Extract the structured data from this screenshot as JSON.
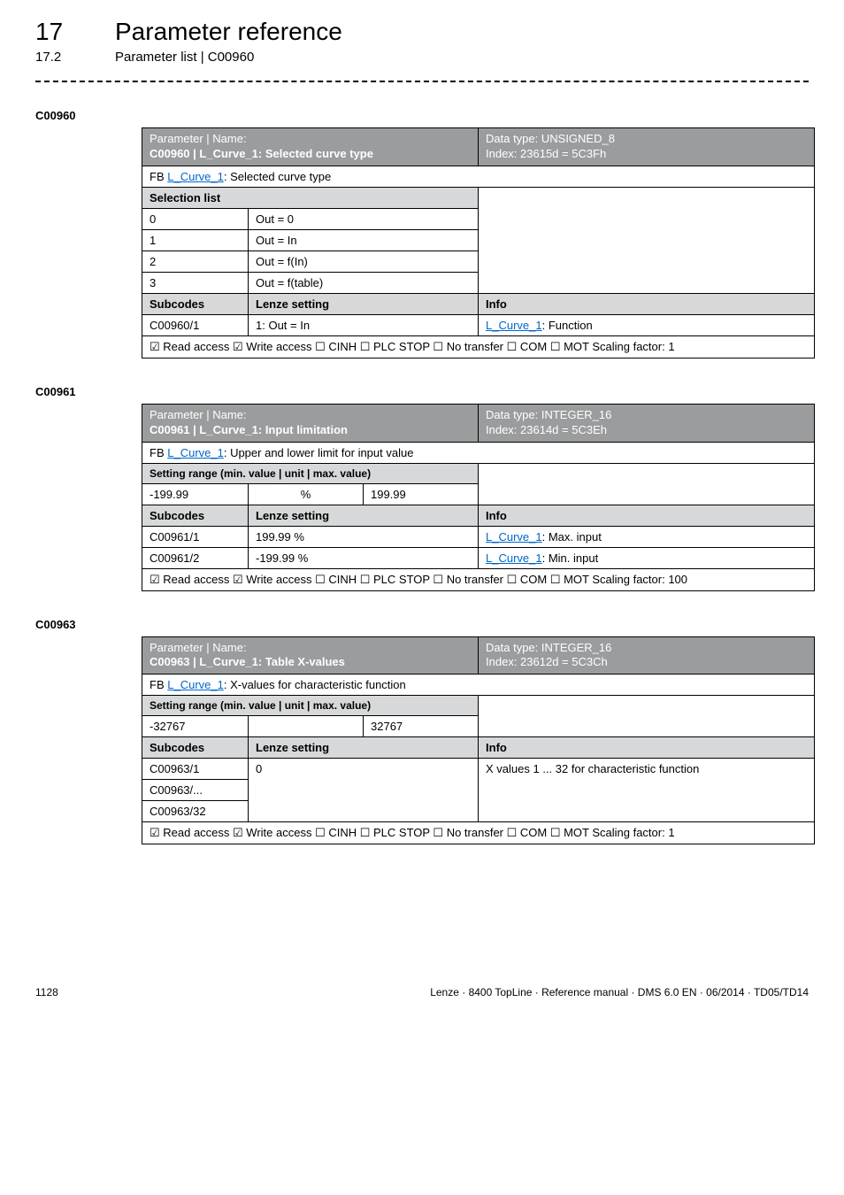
{
  "header": {
    "chapter_num": "17",
    "chapter_title": "Parameter reference",
    "section_num": "17.2",
    "section_title": "Parameter list | C00960"
  },
  "p960": {
    "code": "C00960",
    "title_line1": "Parameter | Name:",
    "title_line2": "C00960 | L_Curve_1: Selected curve type",
    "datatype": "Data type: UNSIGNED_8",
    "index": "Index: 23615d = 5C3Fh",
    "fb_prefix": "FB ",
    "fb_link": "L_Curve_1",
    "fb_suffix": ": Selected curve type",
    "selection_list": "Selection list",
    "rows": [
      {
        "n": "0",
        "v": "Out = 0"
      },
      {
        "n": "1",
        "v": "Out = In"
      },
      {
        "n": "2",
        "v": "Out = f(In)"
      },
      {
        "n": "3",
        "v": "Out = f(table)"
      }
    ],
    "subcodes_hdr": "Subcodes",
    "lenze_hdr": "Lenze setting",
    "info_hdr": "Info",
    "sub1": "C00960/1",
    "sub1_val": "1: Out = In",
    "sub1_info_link": "L_Curve_1",
    "sub1_info_suffix": ": Function",
    "access": "☑ Read access   ☑ Write access   ☐ CINH   ☐ PLC STOP   ☐ No transfer   ☐ COM   ☐ MOT     Scaling factor: 1"
  },
  "p961": {
    "code": "C00961",
    "title_line1": "Parameter | Name:",
    "title_line2": "C00961 | L_Curve_1: Input limitation",
    "datatype": "Data type: INTEGER_16",
    "index": "Index: 23614d = 5C3Eh",
    "fb_prefix": "FB ",
    "fb_link": "L_Curve_1",
    "fb_suffix": ": Upper and lower limit for input value",
    "setting_hdr": "Setting range (min. value | unit | max. value)",
    "min": "-199.99",
    "unit": "%",
    "max": "199.99",
    "subcodes_hdr": "Subcodes",
    "lenze_hdr": "Lenze setting",
    "info_hdr": "Info",
    "rows": [
      {
        "sub": "C00961/1",
        "val": "199.99 %",
        "suffix": ": Max. input"
      },
      {
        "sub": "C00961/2",
        "val": "-199.99 %",
        "suffix": ": Min. input"
      }
    ],
    "info_link": "L_Curve_1",
    "access": "☑ Read access   ☑ Write access   ☐ CINH   ☐ PLC STOP   ☐ No transfer   ☐ COM   ☐ MOT     Scaling factor: 100"
  },
  "p963": {
    "code": "C00963",
    "title_line1": "Parameter | Name:",
    "title_line2": "C00963 | L_Curve_1: Table X-values",
    "datatype": "Data type: INTEGER_16",
    "index": "Index: 23612d = 5C3Ch",
    "fb_prefix": "FB ",
    "fb_link": "L_Curve_1",
    "fb_suffix": ": X-values for characteristic function",
    "setting_hdr": "Setting range (min. value | unit | max. value)",
    "min": "-32767",
    "unit": "",
    "max": "32767",
    "subcodes_hdr": "Subcodes",
    "lenze_hdr": "Lenze setting",
    "info_hdr": "Info",
    "rows": [
      {
        "sub": "C00963/1",
        "val": "0",
        "info": "X values 1 ... 32 for characteristic function"
      },
      {
        "sub": "C00963/...",
        "val": "",
        "info": ""
      },
      {
        "sub": "C00963/32",
        "val": "",
        "info": ""
      }
    ],
    "access": "☑ Read access   ☑ Write access   ☐ CINH   ☐ PLC STOP   ☐ No transfer   ☐ COM   ☐ MOT     Scaling factor: 1"
  },
  "footer": {
    "page": "1128",
    "right": "Lenze · 8400 TopLine · Reference manual · DMS 6.0 EN · 06/2014 · TD05/TD14"
  }
}
